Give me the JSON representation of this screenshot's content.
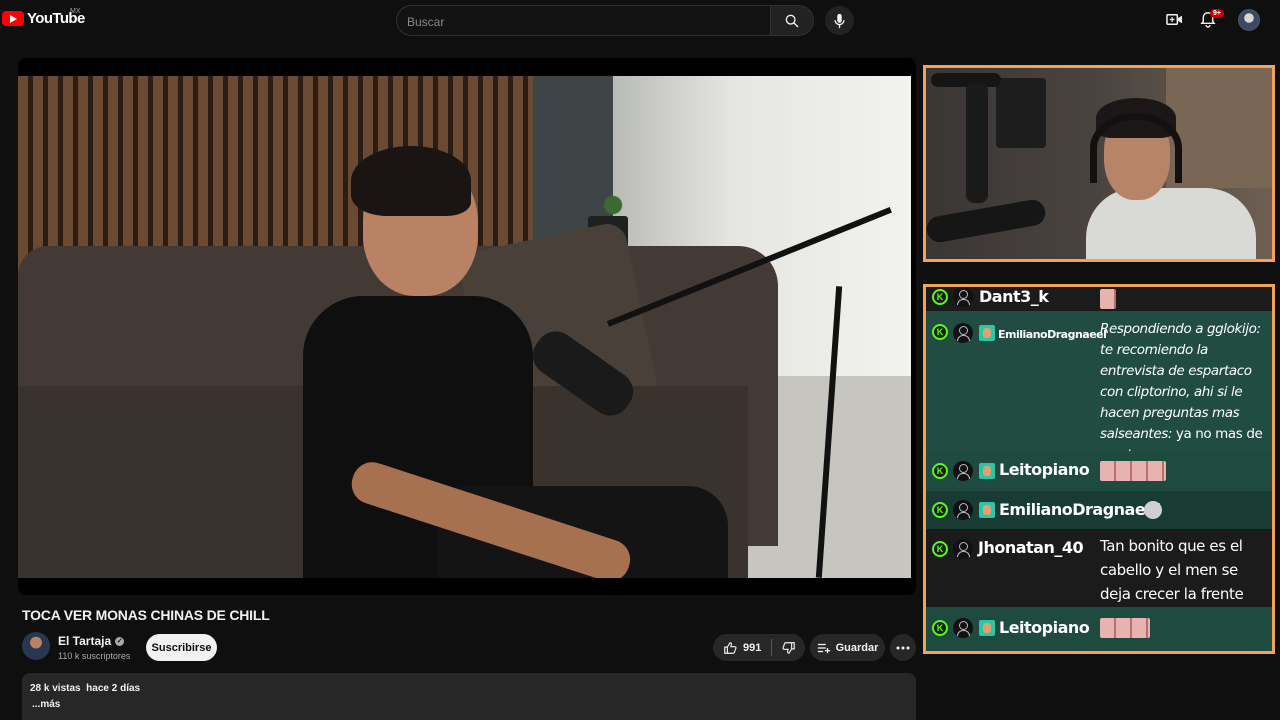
{
  "header": {
    "logo_text": "YouTube",
    "region": "MX",
    "search_placeholder": "Buscar",
    "notification_count": "9+"
  },
  "video": {
    "title": "TOCA VER MONAS CHINAS DE CHILL",
    "channel_name": "El Tartaja",
    "subscribers": "110 k suscriptores",
    "subscribe_label": "Suscribirse",
    "likes": "991",
    "save_label": "Guardar",
    "views": "28 k vistas",
    "age": "hace 2 días",
    "more_label": "...más"
  },
  "chat": {
    "messages": [
      {
        "user": "Dant3_k",
        "text": "",
        "emote": true
      },
      {
        "user": "EmilianoDragnaeel",
        "text": "Respondiendo a gglokijo: te recomiendo la entrevista de espartaco con cliptorino, ahi si le hacen preguntas mas salseantes:",
        "text2": "ya no mas de spartac",
        "sub_badge": true
      },
      {
        "user": "Leitopiano",
        "text": "",
        "emote": true,
        "sub_badge": true
      },
      {
        "user": "EmilianoDragnaeel",
        "text": "",
        "emote": true,
        "sub_badge": true
      },
      {
        "user": "Jhonatan_40",
        "text": "Tan bonito que es el cabello y el men se deja crecer la frente"
      },
      {
        "user": "Leitopiano",
        "text": "",
        "emote": true,
        "sub_badge": true
      }
    ]
  },
  "colors": {
    "accent_border": "#f0a35b",
    "kick_green": "#53fc18",
    "youtube_red": "#ff0000"
  }
}
